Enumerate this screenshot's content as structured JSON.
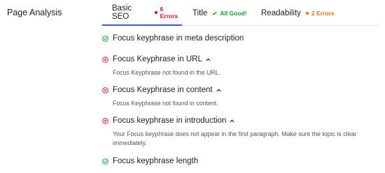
{
  "section": {
    "title": "Page Analysis"
  },
  "tabs": [
    {
      "label": "Basic SEO",
      "badge": "6 Errors",
      "badge_type": "error",
      "active": true
    },
    {
      "label": "Title",
      "badge": "All Good!",
      "badge_type": "good",
      "active": false
    },
    {
      "label": "Readability",
      "badge": "2 Errors",
      "badge_type": "warning",
      "active": false
    }
  ],
  "colors": {
    "accent": "#3858e9",
    "error": "#cc1818",
    "warning": "#d97706",
    "good": "#00a32a"
  },
  "results": [
    {
      "status": "good",
      "icon": "check-circle-icon",
      "label": "Focus keyphrase in meta description",
      "expandable": false,
      "description": ""
    },
    {
      "status": "error",
      "icon": "error-circle-icon",
      "label": "Focus Keyphrase in URL",
      "expandable": true,
      "description": "Focus Keyphrase not found in the URL."
    },
    {
      "status": "error",
      "icon": "error-circle-icon",
      "label": "Focus Keyphrase in content",
      "expandable": true,
      "description": "Focus Keyphrase not found in content."
    },
    {
      "status": "error",
      "icon": "error-circle-icon",
      "label": "Focus keyphrase in introduction",
      "expandable": true,
      "description": "Your Focus keyphrase does not appear in the first paragraph. Make sure the topic is clear immediately."
    },
    {
      "status": "good",
      "icon": "check-circle-icon",
      "label": "Focus keyphrase length",
      "expandable": false,
      "description": ""
    }
  ]
}
